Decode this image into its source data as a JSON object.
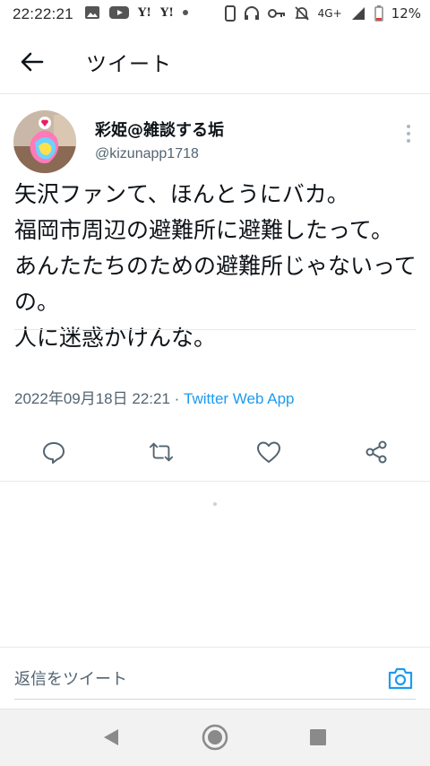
{
  "status_bar": {
    "time": "22:22:21",
    "network": "4G+",
    "battery": "12%",
    "icons": [
      "image-icon",
      "youtube-icon",
      "yahoo-icon",
      "yahoo-icon",
      "dot-icon",
      "phone-icon",
      "headphones-icon",
      "key-icon",
      "mute-icon",
      "signal-icon",
      "battery-icon"
    ]
  },
  "header": {
    "title": "ツイート"
  },
  "tweet": {
    "display_name": "彩姫@雑談する垢",
    "handle": "@kizunapp1718",
    "text": "矢沢ファンて、ほんとうにバカ。\n福岡市周辺の避難所に避難したって。\nあんたたちのための避難所じゃないっての。\n人に迷惑かけんな。",
    "timestamp": "2022年09月18日 22:21",
    "separator": " · ",
    "source": "Twitter Web App"
  },
  "actions": [
    "reply-icon",
    "retweet-icon",
    "like-icon",
    "share-icon"
  ],
  "reply": {
    "placeholder": "返信をツイート"
  },
  "colors": {
    "accent": "#1d9bf0",
    "text": "#0f1419",
    "secondary": "#536471",
    "border": "#e6e9ec"
  }
}
